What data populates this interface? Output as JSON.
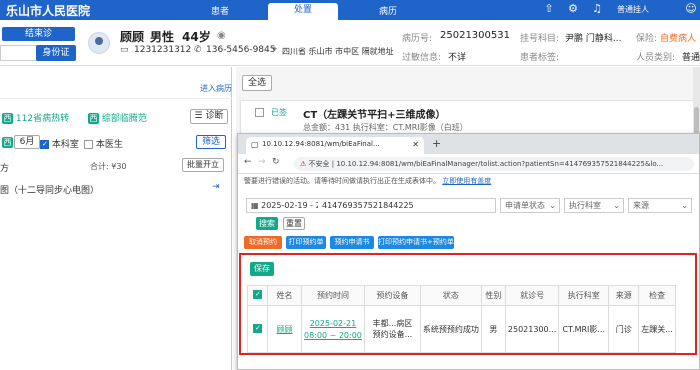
{
  "topbar": {
    "title": "乐山市人民医院",
    "tabs": [
      "患者",
      "处置",
      "病历"
    ],
    "user": "普通挂人"
  },
  "header": {
    "btn_end": "结束诊",
    "btn_id": "身份证",
    "patient_name": "顾顾",
    "patient_sex": "男性",
    "patient_age": "44岁",
    "id_number": "1231231312",
    "phone": "136-5456-9845",
    "address": "四川省 乐山市 市中区 隔就地址",
    "visit_label": "病历号:",
    "visit_no": "25021300531",
    "dept_label": "挂号科目:",
    "dept_value": "尹鹏 门静科...",
    "insurance_label": "保险:",
    "insurance_value": "自费病人",
    "allergy_label": "过敏信息:",
    "allergy_value": "不详",
    "tags_label": "患者标签:",
    "type_label": "人员类别:",
    "type_value": "普通"
  },
  "left": {
    "pid_placeholder": "",
    "enter_record": "进入病历",
    "badge1_num": "112",
    "badge1_text": "省病热转",
    "badge2_text": "综部临腾范",
    "diag_btn": "诊断",
    "west_label": "西",
    "month": "6月",
    "this_dept": "本科室",
    "this_doctor": "本医生",
    "filter_btn": "筛选",
    "total_label": "合计: ¥30",
    "bulk_btn": "批量开立",
    "item_text": "图（十二导同步心电图）",
    "sec_label": "方"
  },
  "right": {
    "select_all": "全选",
    "order_status": "已签",
    "order_title": "CT（左踝关节平扫+三维成像）",
    "order_sub": "总金额：431  执行科室：CT.MRI影像（白班）"
  },
  "browser": {
    "tab_title": "10.10.12.94:8081/wm/biEaFinal...",
    "tab_plus": "+",
    "insecure": "不安全",
    "url": "10.10.12.94:8081/wm/biEaFinalManager/tolist.action?patientSn=414769357521844225&lo...",
    "warn_text": "警要进行错误的活动。请等待时间做请执行出正在生成表体中。",
    "warn_link": "立即使用有盖度",
    "date_range": "2025-02-19  -  2025-02-21",
    "patient_sn": "414769357521844225",
    "status_select": "申请单状态",
    "exec_select": "执行科室",
    "source_select": "来源",
    "query_btn": "搜索",
    "reset_btn": "重置",
    "cancel_btn": "取消预约",
    "print_btn": "打印预约单",
    "print_sheet_btn": "预约申请书",
    "print_combo_btn": "打印预约申请书+预约单",
    "save_btn": "保存"
  },
  "table": {
    "headers": [
      "",
      "姓名",
      "预约时间",
      "预约设备",
      "状态",
      "性别",
      "就诊号",
      "执行科室",
      "来源",
      "检查"
    ],
    "rows": [
      {
        "name": "顾顾",
        "time_date": "2025-02-21",
        "time_range": "08:00 ~ 20:00",
        "device": "丰都...病区",
        "device2": "预约设备...",
        "status": "系统预预约成功",
        "sex": "男",
        "visit_no": "25021300...",
        "dept": "CT.MRI影...",
        "source": "门诊",
        "exam": "左踝关..."
      }
    ]
  },
  "colors": {
    "brand": "#1f64c8",
    "teal": "#13a889",
    "orange": "#f06b24",
    "highlight": "#e02424"
  }
}
